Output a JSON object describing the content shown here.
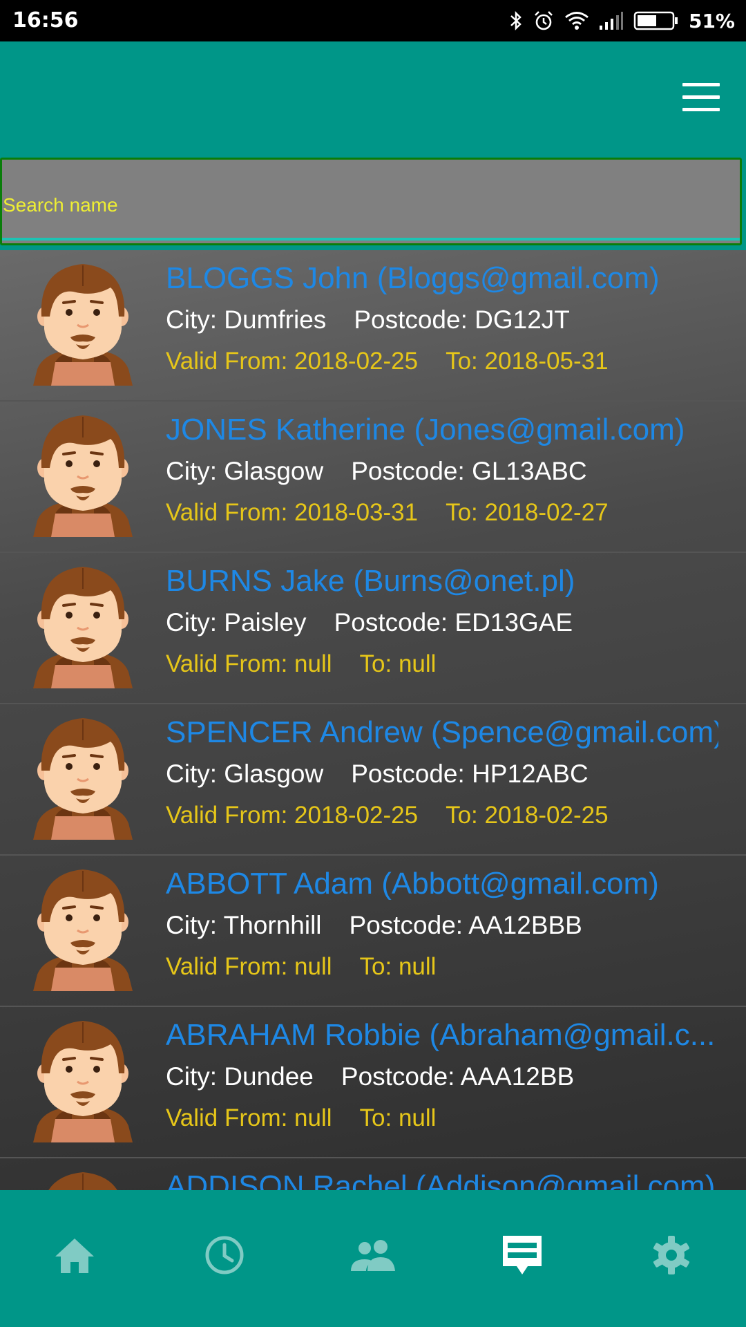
{
  "status_bar": {
    "time": "16:56",
    "battery": "51%"
  },
  "search": {
    "placeholder": "Search name"
  },
  "contacts": [
    {
      "name": "BLOGGS John (Bloggs@gmail.com)",
      "city": "City: Dumfries",
      "postcode": "Postcode: DG12JT",
      "valid_from": "Valid From: 2018-02-25",
      "valid_to": "To: 2018-05-31"
    },
    {
      "name": "JONES Katherine (Jones@gmail.com)",
      "city": "City: Glasgow",
      "postcode": "Postcode: GL13ABC",
      "valid_from": "Valid From: 2018-03-31",
      "valid_to": "To: 2018-02-27"
    },
    {
      "name": "BURNS Jake (Burns@onet.pl)",
      "city": "City: Paisley",
      "postcode": "Postcode: ED13GAE",
      "valid_from": "Valid From: null",
      "valid_to": "To: null"
    },
    {
      "name": "SPENCER Andrew (Spence@gmail.com)",
      "city": "City: Glasgow",
      "postcode": "Postcode: HP12ABC",
      "valid_from": "Valid From: 2018-02-25",
      "valid_to": "To: 2018-02-25"
    },
    {
      "name": "ABBOTT Adam (Abbott@gmail.com)",
      "city": "City: Thornhill",
      "postcode": "Postcode: AA12BBB",
      "valid_from": "Valid From: null",
      "valid_to": "To: null"
    },
    {
      "name": "ABRAHAM Robbie (Abraham@gmail.c...",
      "city": "City: Dundee",
      "postcode": "Postcode: AAA12BB",
      "valid_from": "Valid From: null",
      "valid_to": "To: null"
    },
    {
      "name": "ADDISON Rachel (Addison@gmail.com)",
      "city": "",
      "postcode": "",
      "valid_from": "",
      "valid_to": ""
    }
  ],
  "bottom_nav": [
    {
      "icon": "home-icon",
      "active": false
    },
    {
      "icon": "clock-icon",
      "active": false
    },
    {
      "icon": "people-icon",
      "active": false
    },
    {
      "icon": "card-icon",
      "active": true
    },
    {
      "icon": "gear-icon",
      "active": false
    }
  ],
  "colors": {
    "primary": "#009688",
    "name_text": "#1e88e5",
    "date_text": "#e6c619",
    "nav_icon": "#80cbc4",
    "nav_icon_active": "#ffffff"
  }
}
